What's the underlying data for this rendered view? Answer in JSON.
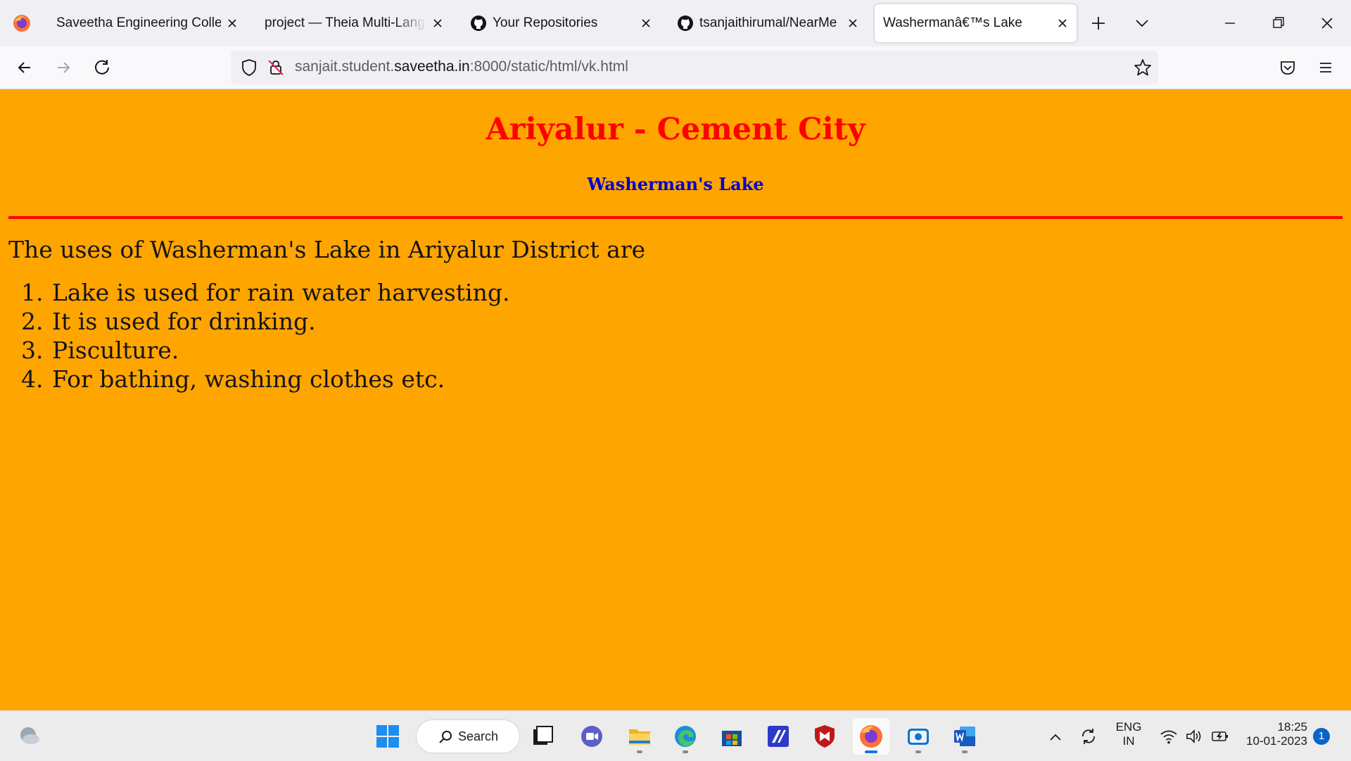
{
  "browser": {
    "tabs": [
      {
        "title": "Saveetha Engineering College",
        "github_icon": false,
        "active": false
      },
      {
        "title": "project — Theia Multi-Language",
        "github_icon": false,
        "active": false
      },
      {
        "title": "Your Repositories",
        "github_icon": true,
        "active": false
      },
      {
        "title": "tsanjaithirumal/NearMe",
        "github_icon": true,
        "active": false
      },
      {
        "title": "Washermanâ€™s Lake",
        "github_icon": false,
        "active": true
      }
    ],
    "url": {
      "prefix": "sanjait.student.",
      "domain": "saveetha.in",
      "path": ":8000/static/html/vk.html"
    }
  },
  "page": {
    "title": "Ariyalur - Cement City",
    "subtitle": "Washerman's Lake",
    "intro": "The uses of Washerman's Lake in Ariyalur District are",
    "uses": [
      "Lake is used for rain water harvesting.",
      "It is used for drinking.",
      "Pisculture.",
      "For bathing, washing clothes etc."
    ],
    "colors": {
      "background": "#ffa500",
      "title": "#ff0000",
      "subtitle": "#0000cd",
      "rule": "#ff0000"
    }
  },
  "taskbar": {
    "search_label": "Search",
    "language_line1": "ENG",
    "language_line2": "IN",
    "time": "18:25",
    "date": "10-01-2023",
    "notification_count": "1"
  }
}
